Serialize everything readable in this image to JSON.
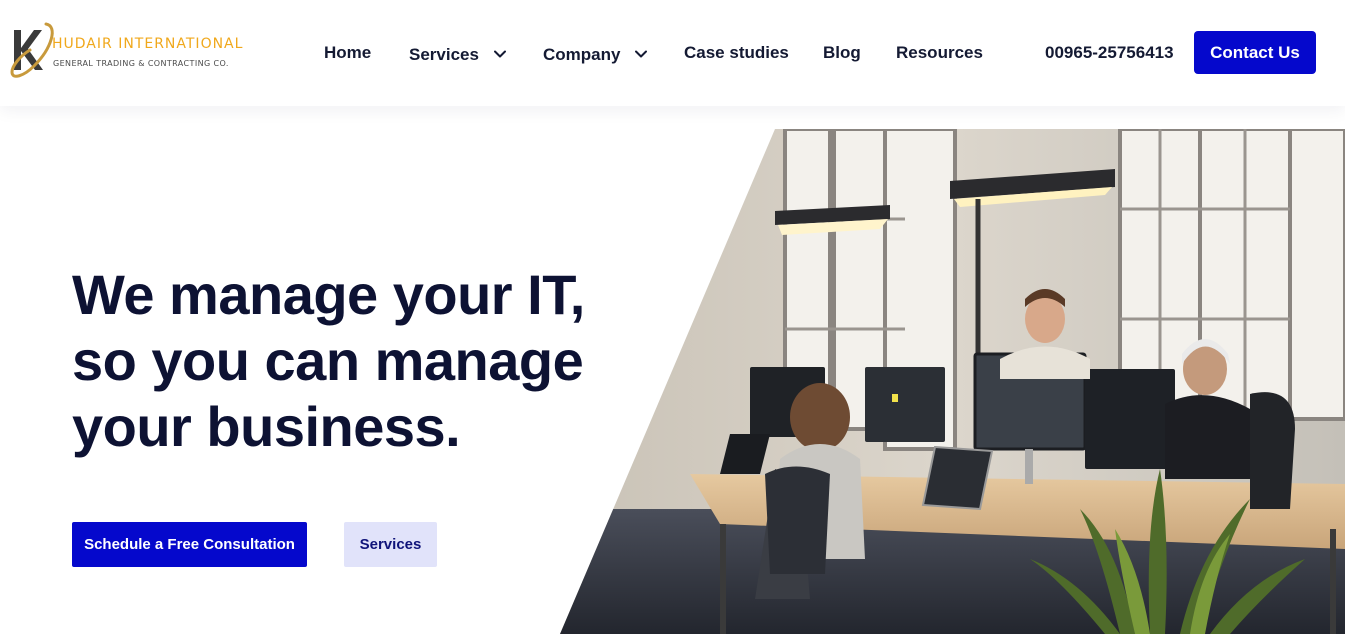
{
  "brand": {
    "name": "HUDAIR INTERNATIONAL",
    "tagline": "GENERAL TRADING & CONTRACTING CO.",
    "logo_letter": "K",
    "accent_gold": "#f0a81c",
    "mark_color": "#3a3a3a"
  },
  "nav": {
    "items": [
      {
        "label": "Home",
        "has_dropdown": false
      },
      {
        "label": "Services",
        "has_dropdown": true
      },
      {
        "label": "Company",
        "has_dropdown": true
      },
      {
        "label": "Case studies",
        "has_dropdown": false
      },
      {
        "label": "Blog",
        "has_dropdown": false
      },
      {
        "label": "Resources",
        "has_dropdown": false
      }
    ],
    "dropdown_icon": "chevron-down-icon"
  },
  "header": {
    "phone": "00965-25756413",
    "contact_label": "Contact Us"
  },
  "hero": {
    "title_lines": [
      "We manage your IT,",
      "so you can manage",
      "your business."
    ],
    "primary_cta": "Schedule a Free Consultation",
    "secondary_cta": "Services",
    "image_subject": "office-team-photo"
  },
  "colors": {
    "primary": "#0508cc",
    "secondary_bg": "#e1e3fa",
    "heading": "#0d1233",
    "nav_text": "#141a33"
  }
}
